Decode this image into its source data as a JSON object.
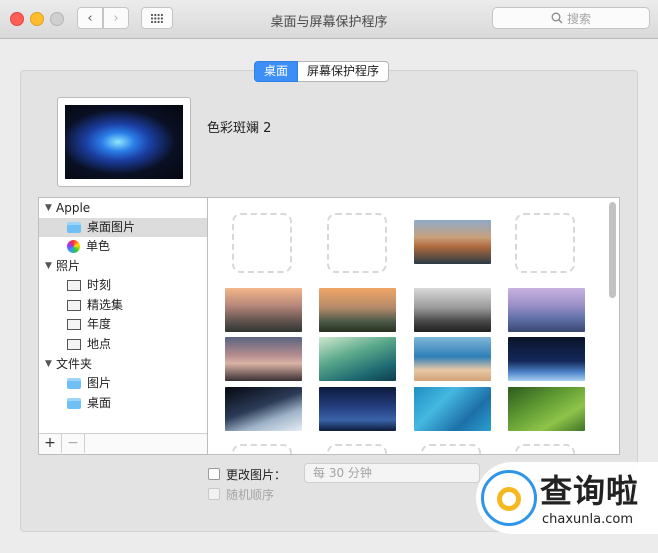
{
  "window": {
    "title": "桌面与屏幕保护程序"
  },
  "toolbar": {
    "back_symbol": "‹",
    "forward_symbol": "›",
    "search_placeholder": "搜索"
  },
  "tabs": [
    {
      "label": "桌面",
      "active": true
    },
    {
      "label": "屏幕保护程序",
      "active": false
    }
  ],
  "current_wallpaper": {
    "name": "色彩斑斓 2"
  },
  "sidebar": {
    "items": [
      {
        "label": "Apple",
        "type": "group"
      },
      {
        "label": "桌面图片",
        "type": "folder",
        "selected": true
      },
      {
        "label": "单色",
        "type": "color"
      },
      {
        "label": "照片",
        "type": "group"
      },
      {
        "label": "时刻",
        "type": "photo"
      },
      {
        "label": "精选集",
        "type": "photo"
      },
      {
        "label": "年度",
        "type": "photo"
      },
      {
        "label": "地点",
        "type": "photo"
      },
      {
        "label": "文件夹",
        "type": "group"
      },
      {
        "label": "图片",
        "type": "folder"
      },
      {
        "label": "桌面",
        "type": "folder"
      }
    ],
    "add_label": "+",
    "remove_label": "−"
  },
  "thumbnails": [
    {
      "name": "empty-slot"
    },
    {
      "name": "empty-slot"
    },
    {
      "name": "el-capitan"
    },
    {
      "name": "empty-slot"
    },
    {
      "name": "yosemite-1"
    },
    {
      "name": "yosemite-2"
    },
    {
      "name": "yosemite-3"
    },
    {
      "name": "yosemite-4"
    },
    {
      "name": "mountain-lake"
    },
    {
      "name": "wave-green"
    },
    {
      "name": "wave-blue"
    },
    {
      "name": "earth-horizon"
    },
    {
      "name": "earth-orbit"
    },
    {
      "name": "milky-way"
    },
    {
      "name": "ocean-water"
    },
    {
      "name": "green-fields"
    }
  ],
  "controls": {
    "change_picture_label": "更改图片：",
    "interval_value": "每 30 分钟",
    "random_order_label": "随机顺序"
  },
  "watermark": {
    "brand": "查询啦",
    "url": "chaxunla.com"
  },
  "colors": {
    "accent": "#3d8ff7",
    "close": "#ff5f57",
    "minimize": "#ffbd2e"
  }
}
